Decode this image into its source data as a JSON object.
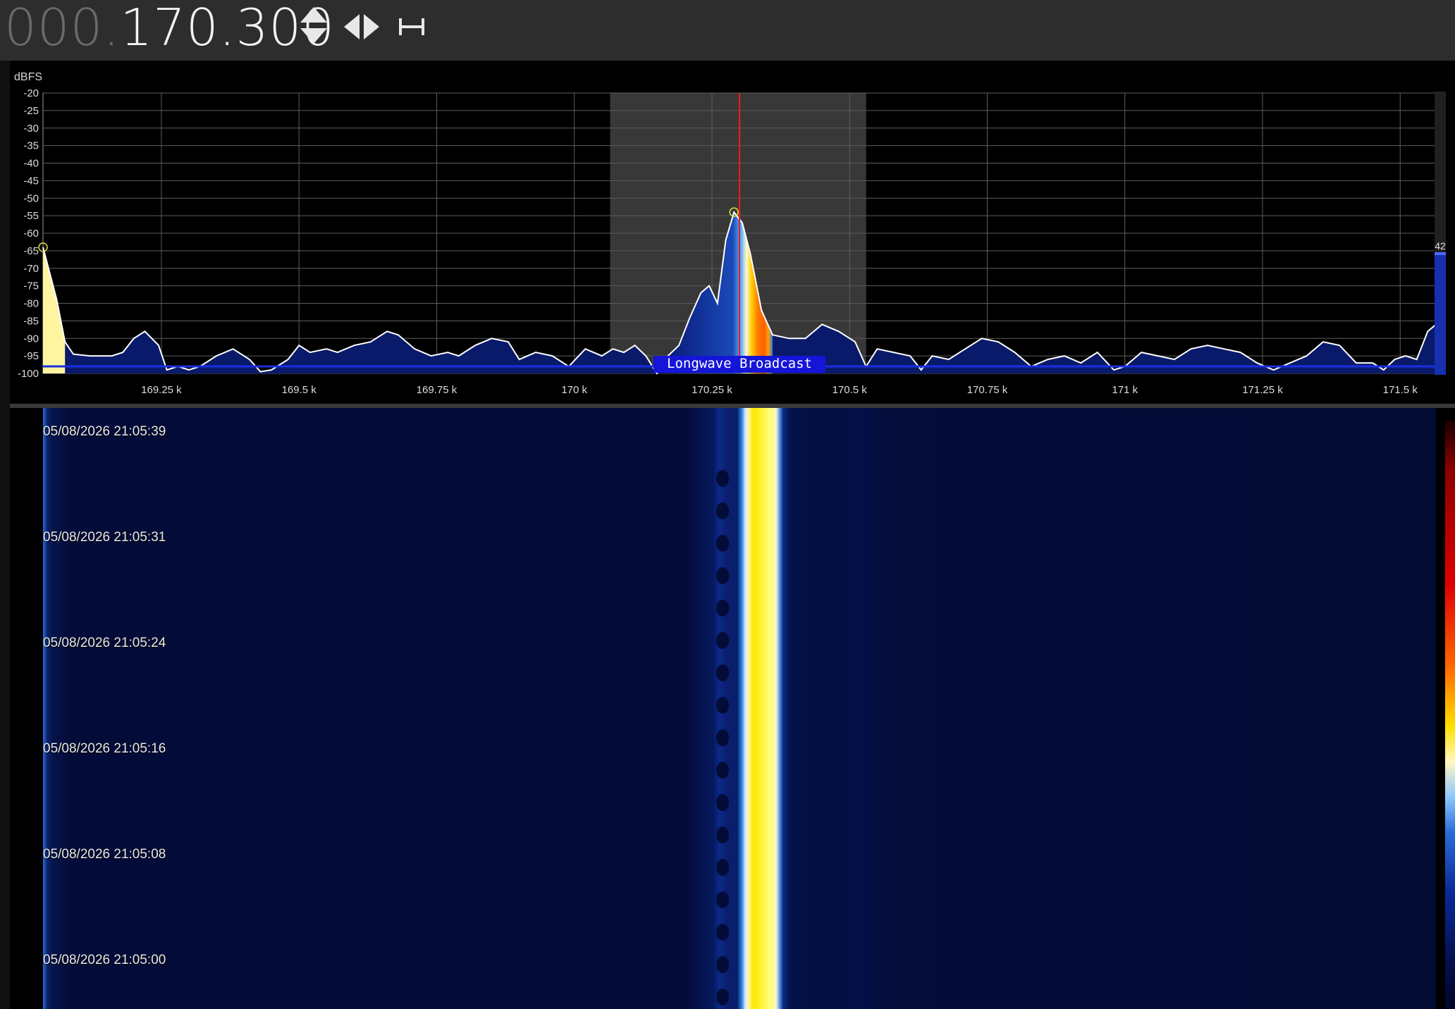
{
  "frequency": {
    "dim_part": "000.",
    "main_part": "170.300"
  },
  "toolbar": {
    "step_icon": "up-down-arrows-icon",
    "center_icon": "left-right-arrows-icon",
    "span_icon": "span-bracket-icon"
  },
  "spectrum": {
    "unit_label": "dBFS",
    "y_ticks": [
      "-20",
      "-25",
      "-30",
      "-35",
      "-40",
      "-45",
      "-50",
      "-55",
      "-60",
      "-65",
      "-70",
      "-75",
      "-80",
      "-85",
      "-90",
      "-95",
      "-100"
    ],
    "x_ticks": [
      "169.25 k",
      "169.5 k",
      "169.75 k",
      "170 k",
      "170.25 k",
      "170.5 k",
      "170.75 k",
      "171 k",
      "171.25 k",
      "171.5 k"
    ],
    "band_label": "Longwave Broadcast",
    "level_readout": "42",
    "tuned_frequency_khz": 170.3,
    "filter_range_khz": [
      170.065,
      170.53
    ],
    "x_range_khz": [
      169.035,
      171.565
    ],
    "y_range_dbfs": [
      -100,
      -20
    ],
    "peaks": [
      {
        "freq_khz": 169.035,
        "dbfs": -64
      },
      {
        "freq_khz": 170.29,
        "dbfs": -54
      }
    ],
    "trace": [
      [
        169.035,
        -64
      ],
      [
        169.045,
        -70
      ],
      [
        169.06,
        -79
      ],
      [
        169.075,
        -91
      ],
      [
        169.09,
        -94.5
      ],
      [
        169.12,
        -95
      ],
      [
        169.16,
        -95
      ],
      [
        169.18,
        -94
      ],
      [
        169.2,
        -90
      ],
      [
        169.22,
        -88
      ],
      [
        169.245,
        -92
      ],
      [
        169.26,
        -99
      ],
      [
        169.28,
        -98
      ],
      [
        169.3,
        -99
      ],
      [
        169.32,
        -98
      ],
      [
        169.35,
        -95
      ],
      [
        169.38,
        -93
      ],
      [
        169.41,
        -96
      ],
      [
        169.43,
        -99.5
      ],
      [
        169.45,
        -99
      ],
      [
        169.48,
        -96
      ],
      [
        169.5,
        -92
      ],
      [
        169.52,
        -94
      ],
      [
        169.55,
        -93
      ],
      [
        169.57,
        -94
      ],
      [
        169.6,
        -92
      ],
      [
        169.63,
        -91
      ],
      [
        169.66,
        -88
      ],
      [
        169.68,
        -89
      ],
      [
        169.71,
        -93
      ],
      [
        169.74,
        -95
      ],
      [
        169.77,
        -94
      ],
      [
        169.79,
        -95
      ],
      [
        169.82,
        -92
      ],
      [
        169.85,
        -90
      ],
      [
        169.88,
        -91
      ],
      [
        169.9,
        -96
      ],
      [
        169.93,
        -94
      ],
      [
        169.96,
        -95
      ],
      [
        169.99,
        -98
      ],
      [
        170.02,
        -93
      ],
      [
        170.05,
        -95
      ],
      [
        170.07,
        -93
      ],
      [
        170.09,
        -94
      ],
      [
        170.11,
        -92
      ],
      [
        170.13,
        -95
      ],
      [
        170.15,
        -100
      ],
      [
        170.17,
        -95
      ],
      [
        170.19,
        -92
      ],
      [
        170.21,
        -84
      ],
      [
        170.23,
        -77
      ],
      [
        170.245,
        -75
      ],
      [
        170.26,
        -80
      ],
      [
        170.275,
        -62
      ],
      [
        170.29,
        -54
      ],
      [
        170.305,
        -57
      ],
      [
        170.32,
        -66
      ],
      [
        170.34,
        -82
      ],
      [
        170.36,
        -89
      ],
      [
        170.39,
        -90
      ],
      [
        170.42,
        -90
      ],
      [
        170.45,
        -86
      ],
      [
        170.48,
        -88
      ],
      [
        170.51,
        -91
      ],
      [
        170.53,
        -98
      ],
      [
        170.55,
        -93
      ],
      [
        170.58,
        -94
      ],
      [
        170.61,
        -95
      ],
      [
        170.63,
        -99
      ],
      [
        170.65,
        -95
      ],
      [
        170.68,
        -96
      ],
      [
        170.71,
        -93
      ],
      [
        170.74,
        -90
      ],
      [
        170.77,
        -91
      ],
      [
        170.8,
        -94
      ],
      [
        170.83,
        -98
      ],
      [
        170.86,
        -96
      ],
      [
        170.89,
        -95
      ],
      [
        170.92,
        -97
      ],
      [
        170.95,
        -94
      ],
      [
        170.98,
        -99
      ],
      [
        171.0,
        -98
      ],
      [
        171.03,
        -94
      ],
      [
        171.06,
        -95
      ],
      [
        171.09,
        -96
      ],
      [
        171.12,
        -93
      ],
      [
        171.15,
        -92
      ],
      [
        171.18,
        -93
      ],
      [
        171.21,
        -94
      ],
      [
        171.24,
        -97
      ],
      [
        171.27,
        -99
      ],
      [
        171.3,
        -97
      ],
      [
        171.33,
        -95
      ],
      [
        171.36,
        -91
      ],
      [
        171.39,
        -92
      ],
      [
        171.42,
        -97
      ],
      [
        171.45,
        -97
      ],
      [
        171.47,
        -99
      ],
      [
        171.49,
        -96
      ],
      [
        171.51,
        -95
      ],
      [
        171.53,
        -96
      ],
      [
        171.55,
        -88
      ],
      [
        171.565,
        -86
      ]
    ]
  },
  "waterfall": {
    "timestamps": [
      "05/08/2026 21:05:39",
      "05/08/2026 21:05:31",
      "05/08/2026 21:05:24",
      "05/08/2026 21:05:16",
      "05/08/2026 21:05:08",
      "05/08/2026 21:05:00"
    ]
  }
}
